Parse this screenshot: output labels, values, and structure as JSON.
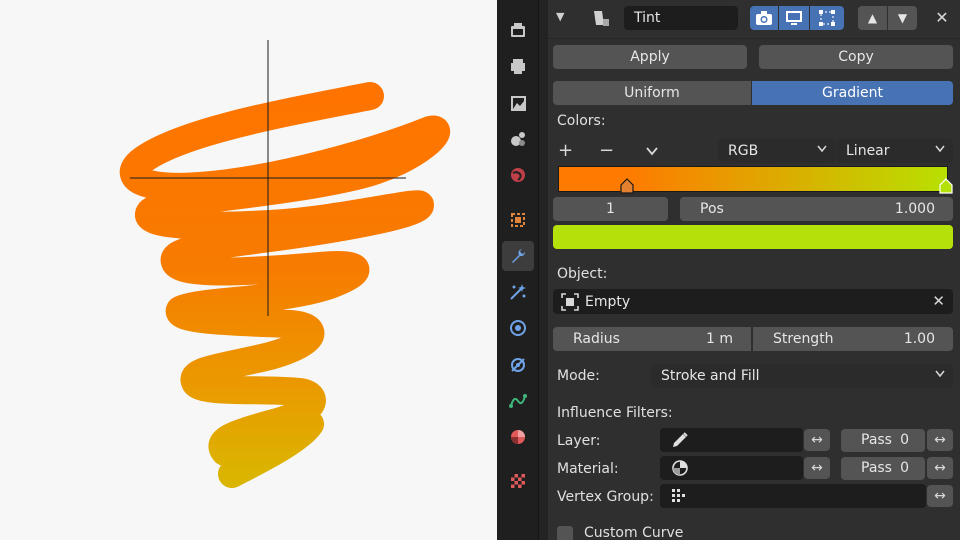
{
  "header": {
    "modifier_name": "Tint",
    "close_glyph": "✕",
    "up_glyph": "▲",
    "down_glyph": "▼"
  },
  "actions": {
    "apply": "Apply",
    "copy": "Copy"
  },
  "mode_tabs": {
    "uniform": "Uniform",
    "gradient": "Gradient",
    "active": "Gradient"
  },
  "colors": {
    "label": "Colors:",
    "add_glyph": "+",
    "remove_glyph": "−",
    "color_mode": "RGB",
    "interpolation": "Linear",
    "stop_index": "1",
    "pos_label": "Pos",
    "pos_value": "1.000",
    "gradient_start": "#ff7a00",
    "gradient_end": "#b8e000",
    "swatch": "#b5e10a"
  },
  "object": {
    "label": "Object:",
    "value": "Empty"
  },
  "radius": {
    "label": "Radius",
    "value": "1 m"
  },
  "strength": {
    "label": "Strength",
    "value": "1.00"
  },
  "mode": {
    "label": "Mode:",
    "value": "Stroke and Fill"
  },
  "influence": {
    "label": "Influence Filters:",
    "layer_label": "Layer:",
    "material_label": "Material:",
    "vertex_group_label": "Vertex Group:",
    "pass_label": "Pass",
    "layer_pass": "0",
    "material_pass": "0",
    "swap_glyph": "↔"
  },
  "custom_curve": {
    "label": "Custom Curve",
    "checked": false
  },
  "sidebar_tabs": [
    "tool-icon",
    "render-icon",
    "output-icon",
    "view-layer-icon",
    "scene-icon",
    "world-icon",
    "object-icon",
    "modifier-icon",
    "particles-icon",
    "physics-icon",
    "constraints-icon",
    "data-icon",
    "material-icon",
    "texture-icon"
  ],
  "accent": "#4772b3"
}
